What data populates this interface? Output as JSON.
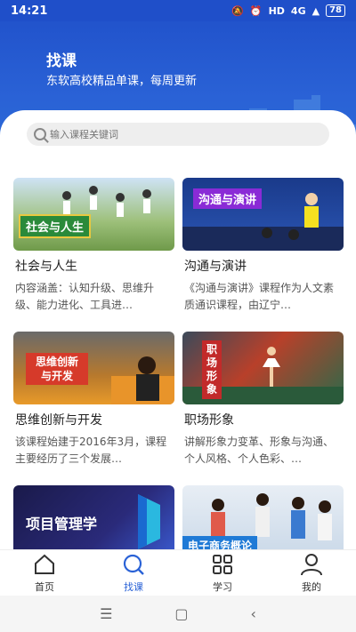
{
  "status": {
    "time": "14:21",
    "network": "4G",
    "hd": "HD",
    "battery": "78"
  },
  "hero": {
    "title": "找课",
    "subtitle": "东软高校精品单课，每周更新"
  },
  "search": {
    "placeholder": "输入课程关键词"
  },
  "courses": [
    {
      "thumb_label": "社会与人生",
      "title": "社会与人生",
      "desc": "内容涵盖：认知升级、思维升级、能力进化、工具进…"
    },
    {
      "thumb_label": "沟通与演讲",
      "title": "沟通与演讲",
      "desc": "《沟通与演讲》课程作为人文素质通识课程，由辽宁…"
    },
    {
      "thumb_label": "思维创新与开发",
      "title": "思维创新与开发",
      "desc": "该课程始建于2016年3月，课程主要经历了三个发展…"
    },
    {
      "thumb_label": "职场形象",
      "title": "职场形象",
      "desc": "讲解形象力变革、形象与沟通、个人风格、个人色彩、…"
    },
    {
      "thumb_label": "项目管理学",
      "title": "",
      "desc": ""
    },
    {
      "thumb_label": "电子商务概论",
      "title": "",
      "desc": ""
    }
  ],
  "tabs": [
    {
      "label": "首页",
      "icon": "home-icon"
    },
    {
      "label": "找课",
      "icon": "search-icon",
      "active": true
    },
    {
      "label": "学习",
      "icon": "grid-icon"
    },
    {
      "label": "我的",
      "icon": "user-icon"
    }
  ],
  "colors": {
    "brand": "#2a62d6",
    "status_bar": "#1f4fc9"
  }
}
